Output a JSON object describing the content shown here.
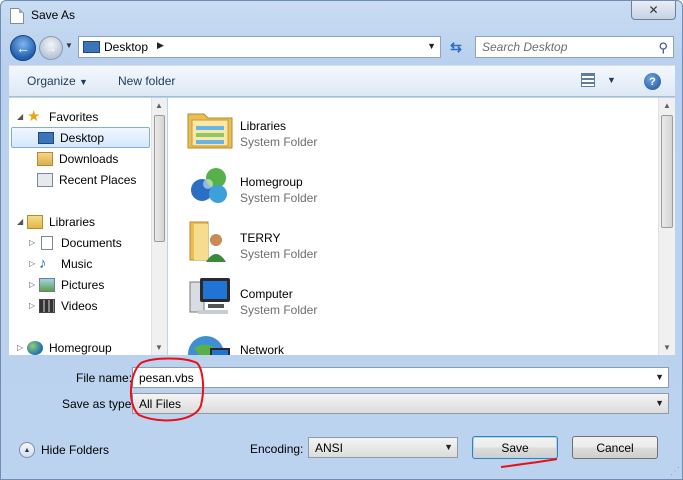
{
  "window": {
    "title": "Save As",
    "close_glyph": "✕"
  },
  "address_bar": {
    "location": "Desktop",
    "search_placeholder": "Search Desktop"
  },
  "toolbar": {
    "organize_label": "Organize",
    "new_folder_label": "New folder"
  },
  "nav_pane": {
    "items": [
      {
        "label": "Favorites",
        "icon": "star-icon"
      },
      {
        "label": "Desktop",
        "icon": "desktop-icon",
        "selected": true
      },
      {
        "label": "Downloads",
        "icon": "downloads-icon"
      },
      {
        "label": "Recent Places",
        "icon": "recent-places-icon"
      },
      {
        "label": "Libraries",
        "icon": "libraries-icon"
      },
      {
        "label": "Documents",
        "icon": "documents-icon"
      },
      {
        "label": "Music",
        "icon": "music-icon"
      },
      {
        "label": "Pictures",
        "icon": "pictures-icon"
      },
      {
        "label": "Videos",
        "icon": "videos-icon"
      },
      {
        "label": "Homegroup",
        "icon": "homegroup-icon"
      }
    ]
  },
  "file_list": {
    "items": [
      {
        "name": "Libraries",
        "type": "System Folder",
        "icon": "libraries-folder-icon"
      },
      {
        "name": "Homegroup",
        "type": "System Folder",
        "icon": "homegroup-icon"
      },
      {
        "name": "TERRY",
        "type": "System Folder",
        "icon": "user-folder-icon"
      },
      {
        "name": "Computer",
        "type": "System Folder",
        "icon": "computer-icon"
      },
      {
        "name": "Network",
        "type": "",
        "icon": "network-icon"
      }
    ]
  },
  "form": {
    "file_name_label": "File name:",
    "file_name_value": "pesan.vbs",
    "save_as_type_label": "Save as type:",
    "save_as_type_value": "All Files",
    "encoding_label": "Encoding:",
    "encoding_value": "ANSI"
  },
  "footer": {
    "hide_folders_label": "Hide Folders",
    "save_label": "Save",
    "cancel_label": "Cancel"
  },
  "colors": {
    "annotation": "#e8101a",
    "accent": "#3c7fb1"
  }
}
